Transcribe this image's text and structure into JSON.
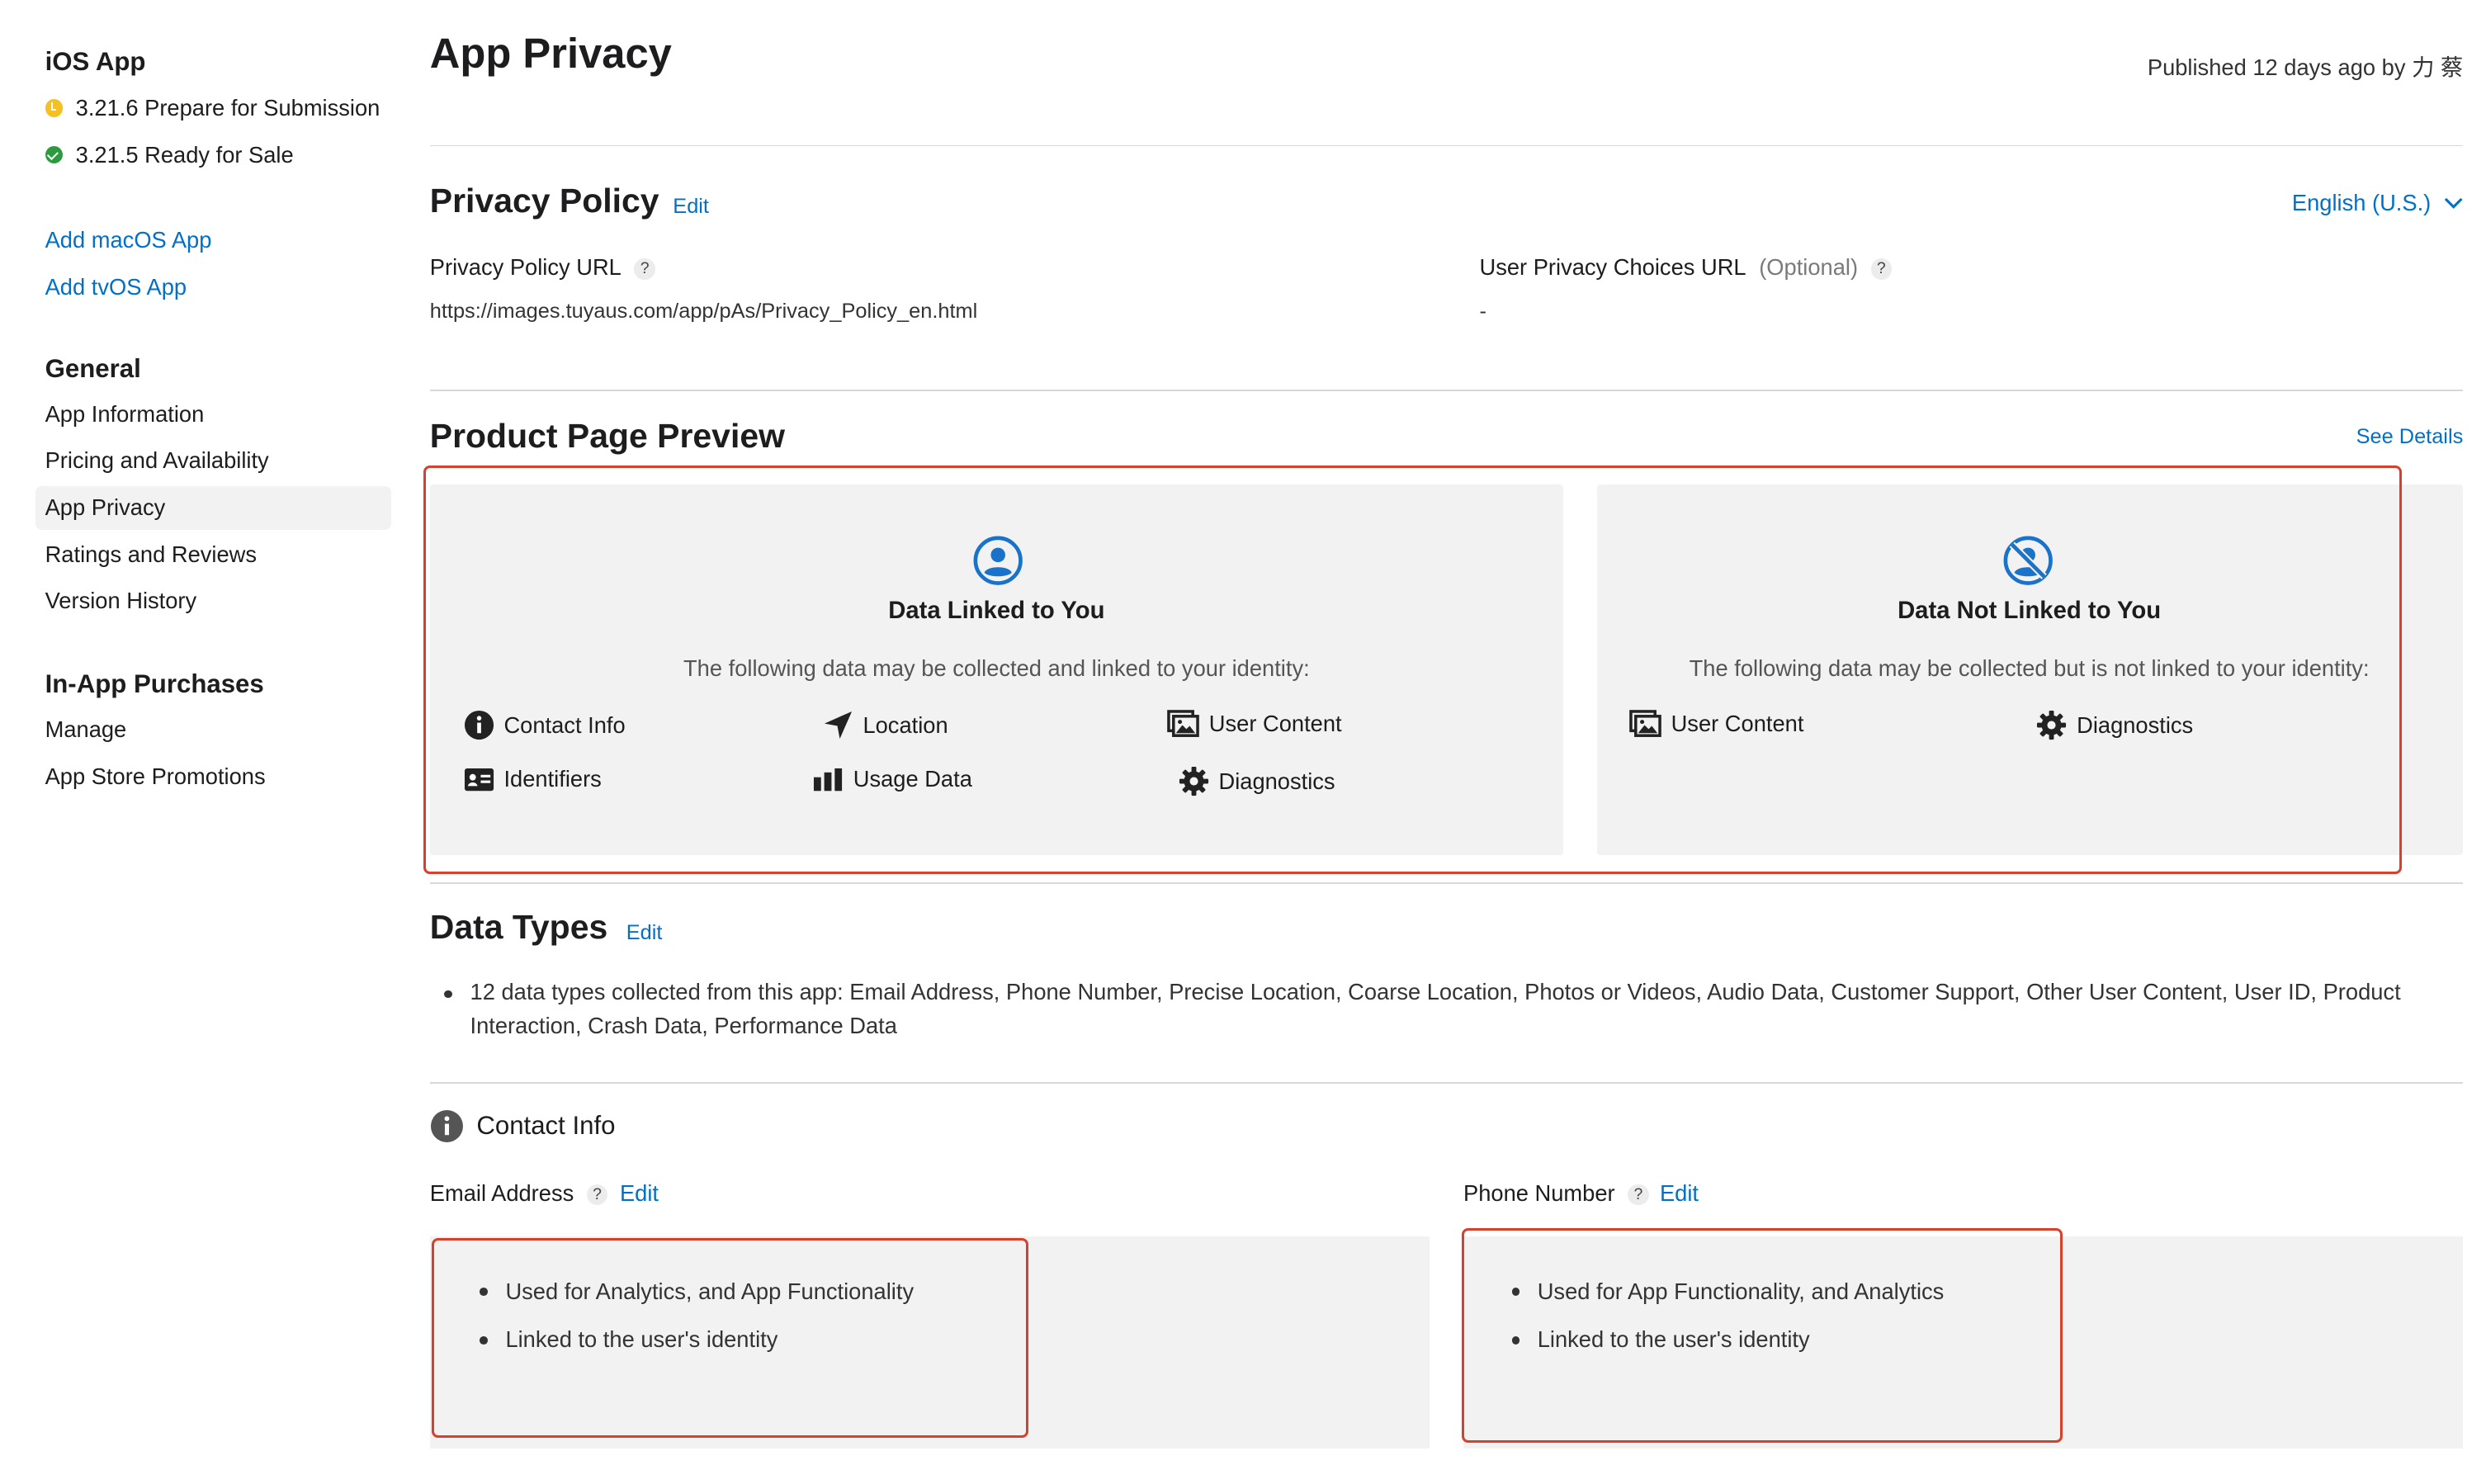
{
  "sidebar": {
    "ios_heading": "iOS App",
    "versions": [
      {
        "label": "3.21.6 Prepare for Submission",
        "status_color": "#f5c021"
      },
      {
        "label": "3.21.5 Ready for Sale",
        "status_color": "#2d9a3f"
      }
    ],
    "add_links": [
      "Add macOS App",
      "Add tvOS App"
    ],
    "general_heading": "General",
    "general_items": [
      "App Information",
      "Pricing and Availability",
      "App Privacy",
      "Ratings and Reviews",
      "Version History"
    ],
    "active_item": "App Privacy",
    "iap_heading": "In-App Purchases",
    "iap_items": [
      "Manage",
      "App Store Promotions"
    ]
  },
  "header": {
    "title": "App Privacy",
    "published": "Published 12 days ago by 力 蔡"
  },
  "privacy_policy": {
    "title": "Privacy Policy",
    "edit": "Edit",
    "language": "English (U.S.)",
    "url_label": "Privacy Policy URL",
    "url_help": "?",
    "url_value": "https://images.tuyaus.com/app/pAs/Privacy_Policy_en.html",
    "choices_label": "User Privacy Choices URL",
    "choices_optional": "(Optional)",
    "choices_help": "?",
    "choices_value": "-"
  },
  "preview": {
    "title": "Product Page Preview",
    "see_details": "See Details",
    "linked": {
      "title": "Data Linked to You",
      "subtitle": "The following data may be collected and linked to your identity:",
      "items": [
        {
          "label": "Contact Info",
          "icon": "info-icon"
        },
        {
          "label": "Location",
          "icon": "location-arrow-icon"
        },
        {
          "label": "User Content",
          "icon": "photos-icon"
        },
        {
          "label": "Identifiers",
          "icon": "id-card-icon"
        },
        {
          "label": "Usage Data",
          "icon": "bar-chart-icon"
        },
        {
          "label": "Diagnostics",
          "icon": "gear-icon"
        }
      ]
    },
    "not_linked": {
      "title": "Data Not Linked to You",
      "subtitle": "The following data may be collected but is not linked to your identity:",
      "items": [
        {
          "label": "User Content",
          "icon": "photos-icon"
        },
        {
          "label": "Diagnostics",
          "icon": "gear-icon"
        }
      ]
    },
    "highlight_color": "#d9402b"
  },
  "data_types": {
    "title": "Data Types",
    "edit": "Edit",
    "summary": "12 data types collected from this app: Email Address, Phone Number, Precise Location, Coarse Location, Photos or Videos, Audio Data, Customer Support, Other User Content, User ID, Product Interaction, Crash Data, Performance Data"
  },
  "contact_info": {
    "title": "Contact Info",
    "email": {
      "label": "Email Address",
      "help": "?",
      "edit": "Edit",
      "uses": [
        "Used for Analytics, and App Functionality",
        "Linked to the user's identity"
      ]
    },
    "phone": {
      "label": "Phone Number",
      "help": "?",
      "edit": "Edit",
      "uses": [
        "Used for App Functionality, and Analytics",
        "Linked to the user's identity"
      ]
    }
  },
  "colors": {
    "link": "#0070c9",
    "panel_bg": "#f2f2f2",
    "icon_blue": "#1a73c9"
  }
}
